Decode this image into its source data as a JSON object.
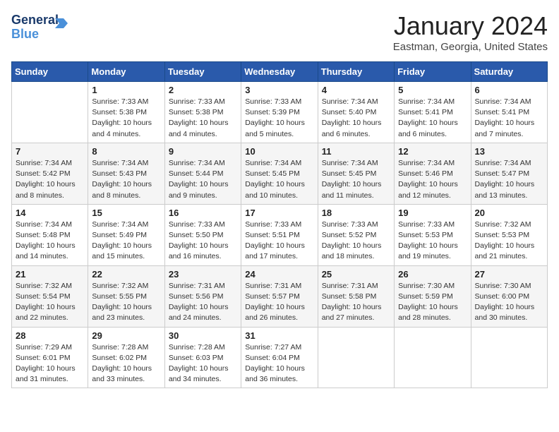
{
  "header": {
    "logo_line1": "General",
    "logo_line2": "Blue",
    "month_title": "January 2024",
    "location": "Eastman, Georgia, United States"
  },
  "days_of_week": [
    "Sunday",
    "Monday",
    "Tuesday",
    "Wednesday",
    "Thursday",
    "Friday",
    "Saturday"
  ],
  "weeks": [
    [
      {
        "day": "",
        "info": ""
      },
      {
        "day": "1",
        "info": "Sunrise: 7:33 AM\nSunset: 5:38 PM\nDaylight: 10 hours\nand 4 minutes."
      },
      {
        "day": "2",
        "info": "Sunrise: 7:33 AM\nSunset: 5:38 PM\nDaylight: 10 hours\nand 4 minutes."
      },
      {
        "day": "3",
        "info": "Sunrise: 7:33 AM\nSunset: 5:39 PM\nDaylight: 10 hours\nand 5 minutes."
      },
      {
        "day": "4",
        "info": "Sunrise: 7:34 AM\nSunset: 5:40 PM\nDaylight: 10 hours\nand 6 minutes."
      },
      {
        "day": "5",
        "info": "Sunrise: 7:34 AM\nSunset: 5:41 PM\nDaylight: 10 hours\nand 6 minutes."
      },
      {
        "day": "6",
        "info": "Sunrise: 7:34 AM\nSunset: 5:41 PM\nDaylight: 10 hours\nand 7 minutes."
      }
    ],
    [
      {
        "day": "7",
        "info": "Sunrise: 7:34 AM\nSunset: 5:42 PM\nDaylight: 10 hours\nand 8 minutes."
      },
      {
        "day": "8",
        "info": "Sunrise: 7:34 AM\nSunset: 5:43 PM\nDaylight: 10 hours\nand 8 minutes."
      },
      {
        "day": "9",
        "info": "Sunrise: 7:34 AM\nSunset: 5:44 PM\nDaylight: 10 hours\nand 9 minutes."
      },
      {
        "day": "10",
        "info": "Sunrise: 7:34 AM\nSunset: 5:45 PM\nDaylight: 10 hours\nand 10 minutes."
      },
      {
        "day": "11",
        "info": "Sunrise: 7:34 AM\nSunset: 5:45 PM\nDaylight: 10 hours\nand 11 minutes."
      },
      {
        "day": "12",
        "info": "Sunrise: 7:34 AM\nSunset: 5:46 PM\nDaylight: 10 hours\nand 12 minutes."
      },
      {
        "day": "13",
        "info": "Sunrise: 7:34 AM\nSunset: 5:47 PM\nDaylight: 10 hours\nand 13 minutes."
      }
    ],
    [
      {
        "day": "14",
        "info": "Sunrise: 7:34 AM\nSunset: 5:48 PM\nDaylight: 10 hours\nand 14 minutes."
      },
      {
        "day": "15",
        "info": "Sunrise: 7:34 AM\nSunset: 5:49 PM\nDaylight: 10 hours\nand 15 minutes."
      },
      {
        "day": "16",
        "info": "Sunrise: 7:33 AM\nSunset: 5:50 PM\nDaylight: 10 hours\nand 16 minutes."
      },
      {
        "day": "17",
        "info": "Sunrise: 7:33 AM\nSunset: 5:51 PM\nDaylight: 10 hours\nand 17 minutes."
      },
      {
        "day": "18",
        "info": "Sunrise: 7:33 AM\nSunset: 5:52 PM\nDaylight: 10 hours\nand 18 minutes."
      },
      {
        "day": "19",
        "info": "Sunrise: 7:33 AM\nSunset: 5:53 PM\nDaylight: 10 hours\nand 19 minutes."
      },
      {
        "day": "20",
        "info": "Sunrise: 7:32 AM\nSunset: 5:53 PM\nDaylight: 10 hours\nand 21 minutes."
      }
    ],
    [
      {
        "day": "21",
        "info": "Sunrise: 7:32 AM\nSunset: 5:54 PM\nDaylight: 10 hours\nand 22 minutes."
      },
      {
        "day": "22",
        "info": "Sunrise: 7:32 AM\nSunset: 5:55 PM\nDaylight: 10 hours\nand 23 minutes."
      },
      {
        "day": "23",
        "info": "Sunrise: 7:31 AM\nSunset: 5:56 PM\nDaylight: 10 hours\nand 24 minutes."
      },
      {
        "day": "24",
        "info": "Sunrise: 7:31 AM\nSunset: 5:57 PM\nDaylight: 10 hours\nand 26 minutes."
      },
      {
        "day": "25",
        "info": "Sunrise: 7:31 AM\nSunset: 5:58 PM\nDaylight: 10 hours\nand 27 minutes."
      },
      {
        "day": "26",
        "info": "Sunrise: 7:30 AM\nSunset: 5:59 PM\nDaylight: 10 hours\nand 28 minutes."
      },
      {
        "day": "27",
        "info": "Sunrise: 7:30 AM\nSunset: 6:00 PM\nDaylight: 10 hours\nand 30 minutes."
      }
    ],
    [
      {
        "day": "28",
        "info": "Sunrise: 7:29 AM\nSunset: 6:01 PM\nDaylight: 10 hours\nand 31 minutes."
      },
      {
        "day": "29",
        "info": "Sunrise: 7:28 AM\nSunset: 6:02 PM\nDaylight: 10 hours\nand 33 minutes."
      },
      {
        "day": "30",
        "info": "Sunrise: 7:28 AM\nSunset: 6:03 PM\nDaylight: 10 hours\nand 34 minutes."
      },
      {
        "day": "31",
        "info": "Sunrise: 7:27 AM\nSunset: 6:04 PM\nDaylight: 10 hours\nand 36 minutes."
      },
      {
        "day": "",
        "info": ""
      },
      {
        "day": "",
        "info": ""
      },
      {
        "day": "",
        "info": ""
      }
    ]
  ]
}
